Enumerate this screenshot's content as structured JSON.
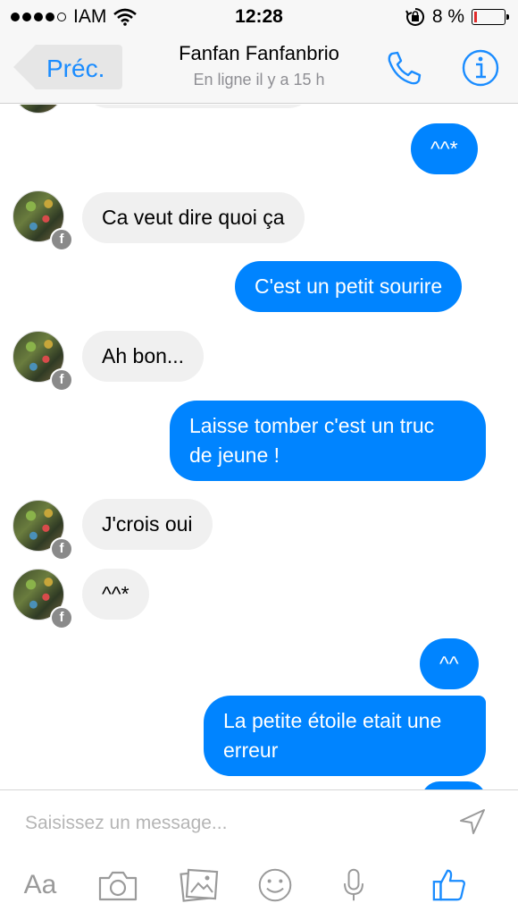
{
  "status_bar": {
    "carrier": "IAM",
    "time": "12:28",
    "battery_percent": "8 %",
    "battery_level": 0.08,
    "battery_color": "#e12b2b"
  },
  "nav": {
    "back_label": "Préc.",
    "contact_name": "Fanfan Fanfanbrio",
    "presence": "En ligne il y a 15 h",
    "accent_color": "#1a8cff"
  },
  "messages": [
    {
      "from": "me",
      "text": "^^*"
    },
    {
      "from": "contact",
      "text": "Ca veut dire quoi ça"
    },
    {
      "from": "me",
      "text": "C'est un petit sourire"
    },
    {
      "from": "contact",
      "text": "Ah bon..."
    },
    {
      "from": "me",
      "lines": [
        "Laisse tomber c'est un truc",
        "de jeune !"
      ]
    },
    {
      "from": "contact",
      "text": "J'crois oui"
    },
    {
      "from": "contact",
      "text": "^^*"
    },
    {
      "from": "me",
      "text": "^^"
    },
    {
      "from": "me",
      "lines": [
        "La petite étoile etait une",
        "erreur"
      ]
    }
  ],
  "composer": {
    "placeholder": "Saisissez un message...",
    "aa_label": "Aa",
    "tools": [
      "text-format-icon",
      "camera-icon",
      "photo-gallery-icon",
      "emoji-icon",
      "microphone-icon",
      "thumbs-up-icon"
    ]
  },
  "colors": {
    "outgoing_bubble": "#0084ff",
    "incoming_bubble": "#f0f0f0"
  }
}
